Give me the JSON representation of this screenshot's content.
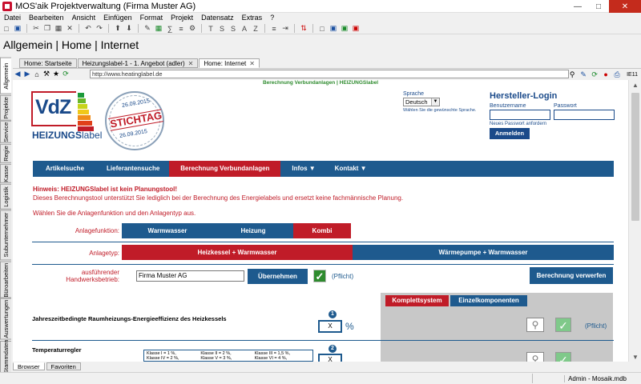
{
  "window": {
    "title": "MOS'aik Projektverwaltung (Firma Muster AG)"
  },
  "menu": [
    "Datei",
    "Bearbeiten",
    "Ansicht",
    "Einfügen",
    "Format",
    "Projekt",
    "Datensatz",
    "Extras",
    "?"
  ],
  "breadcrumb": "Allgemein | Home | Internet",
  "left_tabs": [
    "Allgemein",
    "Projekte",
    "Service",
    "Regie",
    "Kasse",
    "Logistik",
    "Subunternehmer",
    "Büroarbeiten",
    "Auswertungen",
    "Stammdaten"
  ],
  "doc_tabs": [
    {
      "label": "Home: Startseite"
    },
    {
      "label": "Heizungslabel-1 - 1. Angebot (adler)"
    },
    {
      "label": "Home: Internet"
    }
  ],
  "browser": {
    "url": "http://www.heatinglabel.de",
    "ie_label": "IE11"
  },
  "page": {
    "header_text": "Berechnung Verbundanlagen | HEIZUNGSlabel",
    "logo": {
      "vdz": "VdZ",
      "heiz_bold": "HEIZUNGS",
      "heiz_light": "label"
    },
    "stamp": {
      "date_top": "26.09.2015",
      "main": "STICHTAG",
      "date_bottom": "26.09.2015"
    },
    "language": {
      "label": "Sprache",
      "value": "Deutsch",
      "hint": "Wählen Sie die gewünschte Sprache."
    },
    "login": {
      "title": "Hersteller-Login",
      "user_label": "Benutzername",
      "pass_label": "Passwort",
      "forgot": "Neues Passwort anfordern",
      "button": "Anmelden"
    },
    "nav": [
      {
        "label": "Artikelsuche"
      },
      {
        "label": "Lieferantensuche"
      },
      {
        "label": "Berechnung Verbundanlagen"
      },
      {
        "label": "Infos ▼"
      },
      {
        "label": "Kontakt ▼"
      }
    ],
    "warning_title": "Hinweis: HEIZUNGSlabel ist kein Planungstool!",
    "warning_text": "Dieses Berechnungstool unterstützt Sie lediglich bei der Berechnung des Energielabels und ersetzt keine fachmännische Planung.",
    "choose_text": "Wählen Sie die Anlagenfunktion und den Anlagentyp aus.",
    "anlagefunktion": {
      "label": "Anlagefunktion:",
      "options": [
        "Warmwasser",
        "Heizung",
        "Kombi"
      ]
    },
    "anlagetyp": {
      "label": "Anlagetyp:",
      "options": [
        "Heizkessel + Warmwasser",
        "Wärmepumpe + Warmwasser"
      ]
    },
    "betrieb": {
      "label_line1": "ausführender",
      "label_line2": "Handwerksbetrieb:",
      "value": "Firma Muster AG",
      "button": "Übernehmen",
      "pflicht": "(Pflicht)",
      "verwerfen": "Berechnung verwerfen"
    },
    "komponenten": [
      "Komplettsystem",
      "Einzelkomponenten"
    ],
    "row1": {
      "label": "Jahreszeitbedingte Raumheizungs-Energieeffizienz des Heizkessels",
      "num": "1",
      "value": "X",
      "unit": "%",
      "pflicht": "(Pflicht)"
    },
    "row2": {
      "label": "Temperaturregler",
      "num": "2",
      "value": "X"
    },
    "klassen": [
      "Klasse I = 1 %,",
      "Klasse II = 2 %,",
      "Klasse III = 1,5 %,",
      "Klasse IV = 2 %,",
      "Klasse V = 3 %,",
      "Klasse VI = 4 %,"
    ]
  },
  "bottom_tabs": [
    "Browser",
    "Favoriten"
  ],
  "status": {
    "text": "Admin - Mosaik.mdb"
  },
  "colors": {
    "brand_blue": "#1e5a8e",
    "brand_red": "#c01c28",
    "energy_bars": [
      "#1a9a3a",
      "#6ab82a",
      "#c8d41a",
      "#f0c81a",
      "#f08c1a",
      "#e0401a",
      "#c01c28"
    ]
  }
}
